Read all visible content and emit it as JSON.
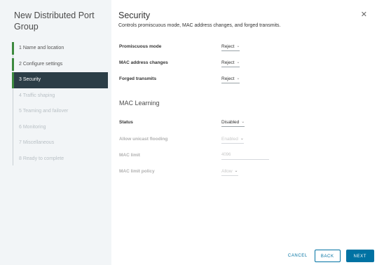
{
  "wizard": {
    "title": "New Distributed Port Group",
    "steps": [
      {
        "label": "1  Name and location",
        "state": "done"
      },
      {
        "label": "2  Configure settings",
        "state": "done"
      },
      {
        "label": "3  Security",
        "state": "active"
      },
      {
        "label": "4  Traffic shaping",
        "state": "pending"
      },
      {
        "label": "5  Teaming and failover",
        "state": "pending"
      },
      {
        "label": "6  Monitoring",
        "state": "pending"
      },
      {
        "label": "7  Miscellaneous",
        "state": "pending"
      },
      {
        "label": "8  Ready to complete",
        "state": "pending"
      }
    ]
  },
  "page": {
    "title": "Security",
    "description": "Controls promiscuous mode, MAC address changes, and forged transmits.",
    "close_icon": "close-icon"
  },
  "security": {
    "promiscuous_mode": {
      "label": "Promiscuous mode",
      "value": "Reject"
    },
    "mac_address_changes": {
      "label": "MAC address changes",
      "value": "Reject"
    },
    "forged_transmits": {
      "label": "Forged transmits",
      "value": "Reject"
    }
  },
  "mac_learning": {
    "title": "MAC Learning",
    "status": {
      "label": "Status",
      "value": "Disabled"
    },
    "allow_unicast_flooding": {
      "label": "Allow unicast flooding",
      "value": "Enabled"
    },
    "mac_limit": {
      "label": "MAC limit",
      "value": "4096"
    },
    "mac_limit_policy": {
      "label": "MAC limit policy",
      "value": "Allow"
    }
  },
  "footer": {
    "cancel_label": "CANCEL",
    "back_label": "BACK",
    "next_label": "NEXT"
  },
  "colors": {
    "accent": "#0072a3",
    "active_step": "#2c3e47",
    "step_marker": "#3c8a3e",
    "nav_background": "#f2f5f7"
  }
}
